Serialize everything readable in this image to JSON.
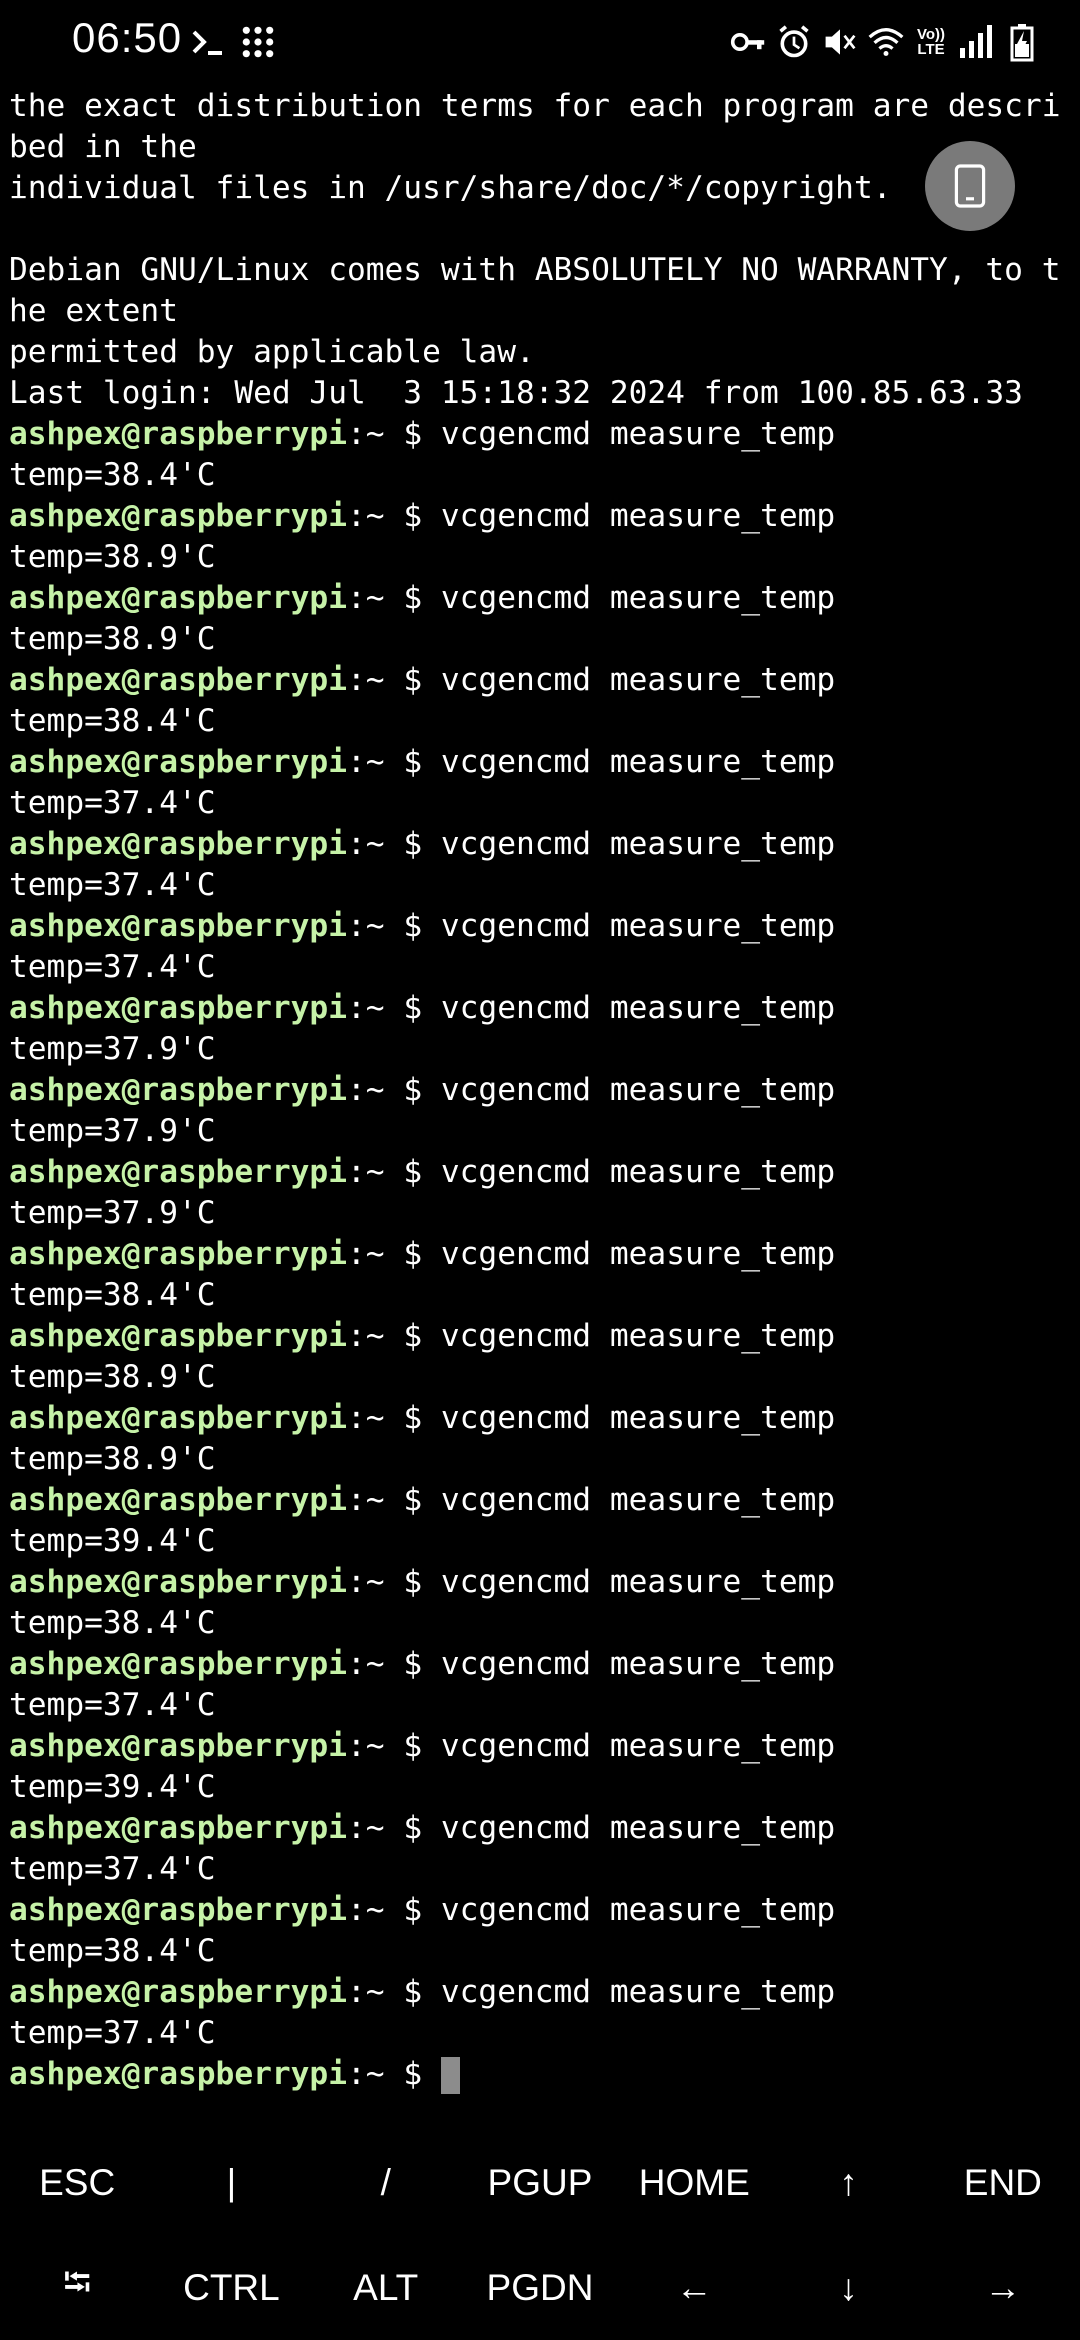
{
  "status_bar": {
    "time": "06:50",
    "left_icons": [
      "terminal-prompt-icon",
      "app-grid-icon"
    ],
    "right_icons": [
      "vpn-key-icon",
      "alarm-icon",
      "mute-icon",
      "wifi-icon",
      "volte-icon",
      "signal-icon",
      "battery-charging-icon"
    ],
    "volte_text": "Vo)) LTE"
  },
  "terminal": {
    "prompt_user": "ashpex@raspberrypi",
    "prompt_path": ":~ $ ",
    "lines": [
      {
        "type": "text",
        "text": "the exact distribution terms for each program are descri"
      },
      {
        "type": "text",
        "text": "bed in the"
      },
      {
        "type": "text",
        "text": "individual files in /usr/share/doc/*/copyright."
      },
      {
        "type": "text",
        "text": ""
      },
      {
        "type": "text",
        "text": "Debian GNU/Linux comes with ABSOLUTELY NO WARRANTY, to t"
      },
      {
        "type": "text",
        "text": "he extent"
      },
      {
        "type": "text",
        "text": "permitted by applicable law."
      },
      {
        "type": "text",
        "text": "Last login: Wed Jul  3 15:18:32 2024 from 100.85.63.33"
      },
      {
        "type": "prompt",
        "text": "vcgencmd measure_temp"
      },
      {
        "type": "text",
        "text": "temp=38.4'C"
      },
      {
        "type": "prompt",
        "text": "vcgencmd measure_temp"
      },
      {
        "type": "text",
        "text": "temp=38.9'C"
      },
      {
        "type": "prompt",
        "text": "vcgencmd measure_temp"
      },
      {
        "type": "text",
        "text": "temp=38.9'C"
      },
      {
        "type": "prompt",
        "text": "vcgencmd measure_temp"
      },
      {
        "type": "text",
        "text": "temp=38.4'C"
      },
      {
        "type": "prompt",
        "text": "vcgencmd measure_temp"
      },
      {
        "type": "text",
        "text": "temp=37.4'C"
      },
      {
        "type": "prompt",
        "text": "vcgencmd measure_temp"
      },
      {
        "type": "text",
        "text": "temp=37.4'C"
      },
      {
        "type": "prompt",
        "text": "vcgencmd measure_temp"
      },
      {
        "type": "text",
        "text": "temp=37.4'C"
      },
      {
        "type": "prompt",
        "text": "vcgencmd measure_temp"
      },
      {
        "type": "text",
        "text": "temp=37.9'C"
      },
      {
        "type": "prompt",
        "text": "vcgencmd measure_temp"
      },
      {
        "type": "text",
        "text": "temp=37.9'C"
      },
      {
        "type": "prompt",
        "text": "vcgencmd measure_temp"
      },
      {
        "type": "text",
        "text": "temp=37.9'C"
      },
      {
        "type": "prompt",
        "text": "vcgencmd measure_temp"
      },
      {
        "type": "text",
        "text": "temp=38.4'C"
      },
      {
        "type": "prompt",
        "text": "vcgencmd measure_temp"
      },
      {
        "type": "text",
        "text": "temp=38.9'C"
      },
      {
        "type": "prompt",
        "text": "vcgencmd measure_temp"
      },
      {
        "type": "text",
        "text": "temp=38.9'C"
      },
      {
        "type": "prompt",
        "text": "vcgencmd measure_temp"
      },
      {
        "type": "text",
        "text": "temp=39.4'C"
      },
      {
        "type": "prompt",
        "text": "vcgencmd measure_temp"
      },
      {
        "type": "text",
        "text": "temp=38.4'C"
      },
      {
        "type": "prompt",
        "text": "vcgencmd measure_temp"
      },
      {
        "type": "text",
        "text": "temp=37.4'C"
      },
      {
        "type": "prompt",
        "text": "vcgencmd measure_temp"
      },
      {
        "type": "text",
        "text": "temp=39.4'C"
      },
      {
        "type": "prompt",
        "text": "vcgencmd measure_temp"
      },
      {
        "type": "text",
        "text": "temp=37.4'C"
      },
      {
        "type": "prompt",
        "text": "vcgencmd measure_temp"
      },
      {
        "type": "text",
        "text": "temp=38.4'C"
      },
      {
        "type": "prompt",
        "text": "vcgencmd measure_temp"
      },
      {
        "type": "text",
        "text": "temp=37.4'C"
      },
      {
        "type": "input",
        "text": ""
      }
    ]
  },
  "floating_button": {
    "icon": "phone-icon"
  },
  "extra_keys": {
    "row1": [
      {
        "label": "ESC",
        "name": "esc-key"
      },
      {
        "label": "|",
        "name": "pipe-key"
      },
      {
        "label": "/",
        "name": "slash-key"
      },
      {
        "label": "PGUP",
        "name": "pgup-key"
      },
      {
        "label": "HOME",
        "name": "home-key"
      },
      {
        "label": "↑",
        "name": "up-arrow-key"
      },
      {
        "label": "END",
        "name": "end-key"
      }
    ],
    "row2": [
      {
        "label": "⭾",
        "name": "tab-key"
      },
      {
        "label": "CTRL",
        "name": "ctrl-key"
      },
      {
        "label": "ALT",
        "name": "alt-key"
      },
      {
        "label": "PGDN",
        "name": "pgdn-key"
      },
      {
        "label": "←",
        "name": "left-arrow-key"
      },
      {
        "label": "↓",
        "name": "down-arrow-key"
      },
      {
        "label": "→",
        "name": "right-arrow-key"
      }
    ]
  },
  "colors": {
    "background": "#000000",
    "prompt_user": "#c6f2a8",
    "text": "#ffffff",
    "cursor": "#8c8c8c",
    "floating_button": "#7a7a7a"
  }
}
